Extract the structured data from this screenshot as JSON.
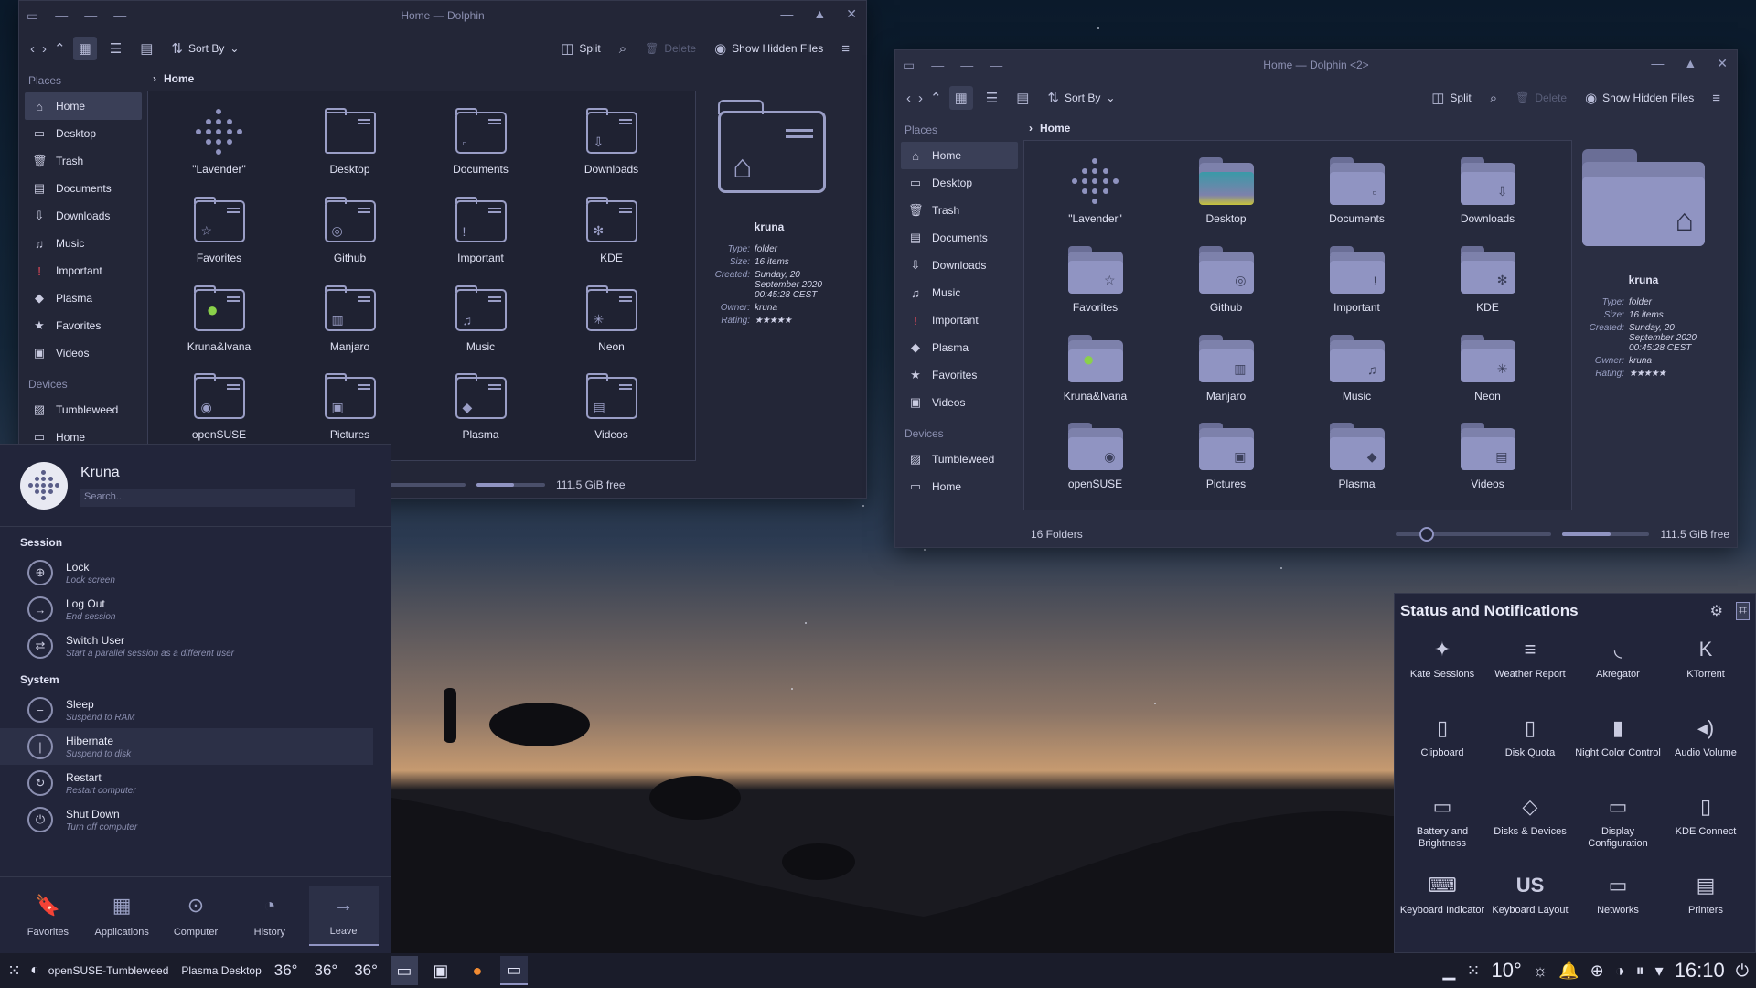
{
  "win1": {
    "title": "Home — Dolphin",
    "toolbar": {
      "sort": "Sort By",
      "split": "Split",
      "delete": "Delete",
      "hidden": "Show Hidden Files"
    },
    "places_label": "Places",
    "devices_label": "Devices",
    "places": [
      "Home",
      "Desktop",
      "Trash",
      "Documents",
      "Downloads",
      "Music",
      "Important",
      "Plasma",
      "Favorites",
      "Videos"
    ],
    "devices": [
      "Tumbleweed",
      "Home"
    ],
    "crumb": "Home",
    "free": "111.5 GiB free",
    "zoom": 0.2,
    "used": 0.55
  },
  "win2": {
    "title": "Home — Dolphin <2>",
    "toolbar": {
      "sort": "Sort By",
      "split": "Split",
      "delete": "Delete",
      "hidden": "Show Hidden Files"
    },
    "places_label": "Places",
    "devices_label": "Devices",
    "places": [
      "Home",
      "Desktop",
      "Trash",
      "Documents",
      "Downloads",
      "Music",
      "Important",
      "Plasma",
      "Favorites",
      "Videos"
    ],
    "devices": [
      "Tumbleweed",
      "Home"
    ],
    "crumb": "Home",
    "count": "16 Folders",
    "free": "111.5 GiB free",
    "zoom": 0.2,
    "used": 0.55
  },
  "folders": [
    "\"Lavender\"",
    "Desktop",
    "Documents",
    "Downloads",
    "Favorites",
    "Github",
    "Important",
    "KDE",
    "Kruna&Ivana",
    "Manjaro",
    "Music",
    "Neon",
    "openSUSE",
    "Pictures",
    "Plasma",
    "Videos"
  ],
  "preview": {
    "name": "kruna",
    "type_k": "Type:",
    "type_v": "folder",
    "size_k": "Size:",
    "size_v": "16 items",
    "created_k": "Created:",
    "created_v": "Sunday, 20 September 2020 00:45:28 CEST",
    "owner_k": "Owner:",
    "owner_v": "kruna",
    "rating_k": "Rating:",
    "rating": 5
  },
  "launcher": {
    "user": "Kruna",
    "search_placeholder": "Search...",
    "session_label": "Session",
    "system_label": "System",
    "session": [
      {
        "title": "Lock",
        "sub": "Lock screen"
      },
      {
        "title": "Log Out",
        "sub": "End session"
      },
      {
        "title": "Switch User",
        "sub": "Start a parallel session as a different user"
      }
    ],
    "system": [
      {
        "title": "Sleep",
        "sub": "Suspend to RAM"
      },
      {
        "title": "Hibernate",
        "sub": "Suspend to disk"
      },
      {
        "title": "Restart",
        "sub": "Restart computer"
      },
      {
        "title": "Shut Down",
        "sub": "Turn off computer"
      }
    ],
    "tabs": [
      "Favorites",
      "Applications",
      "Computer",
      "History",
      "Leave"
    ]
  },
  "notifications": {
    "title": "Status and Notifications",
    "items": [
      {
        "label": "Kate Sessions",
        "icon": "kate-icon"
      },
      {
        "label": "Weather Report",
        "icon": "weather-icon"
      },
      {
        "label": "Akregator",
        "icon": "rss-icon"
      },
      {
        "label": "KTorrent",
        "icon": "ktorrent-icon"
      },
      {
        "label": "Clipboard",
        "icon": "clipboard-icon"
      },
      {
        "label": "Disk Quota",
        "icon": "disk-quota-icon"
      },
      {
        "label": "Night Color Control",
        "icon": "night-color-icon"
      },
      {
        "label": "Audio Volume",
        "icon": "speaker-icon"
      },
      {
        "label": "Battery and Brightness",
        "icon": "battery-icon"
      },
      {
        "label": "Disks & Devices",
        "icon": "disk-icon"
      },
      {
        "label": "Display Configuration",
        "icon": "display-icon"
      },
      {
        "label": "KDE Connect",
        "icon": "phone-icon"
      },
      {
        "label": "Keyboard Indicator",
        "icon": "keyboard-icon"
      },
      {
        "label": "Keyboard Layout",
        "icon": "us-layout-icon",
        "text": "US"
      },
      {
        "label": "Networks",
        "icon": "network-icon"
      },
      {
        "label": "Printers",
        "icon": "printer-icon"
      }
    ]
  },
  "taskbar": {
    "distro": "openSUSE-Tumbleweed",
    "desktop": "Plasma Desktop",
    "temps": [
      "36°",
      "36°",
      "36°"
    ],
    "weather": "10°",
    "clock": "16:10"
  }
}
